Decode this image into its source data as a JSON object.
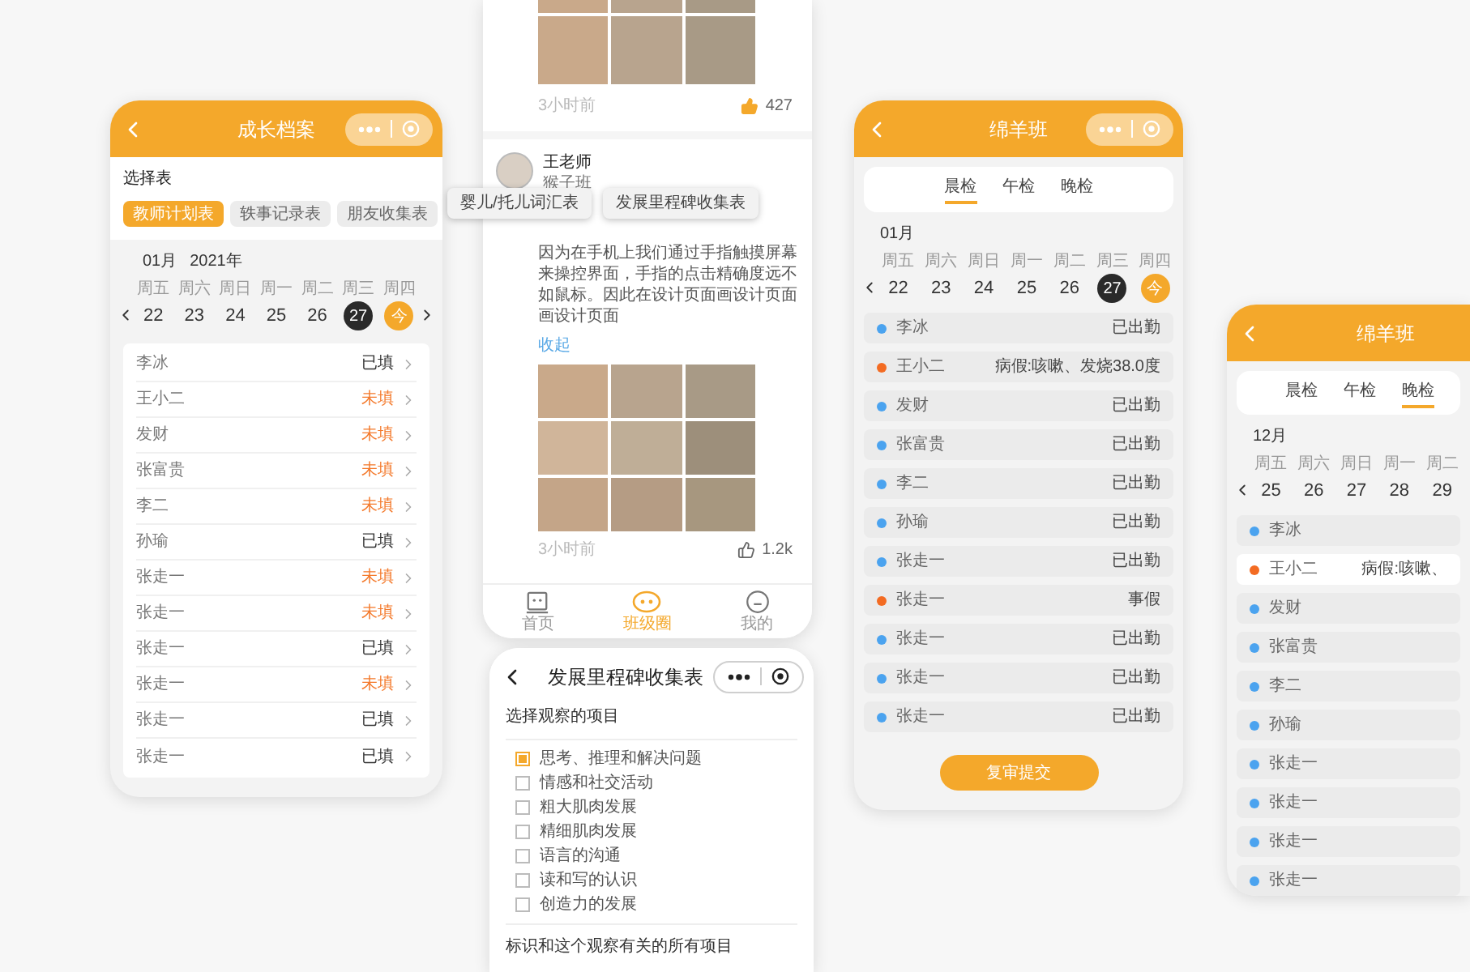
{
  "growth_screen": {
    "title": "成长档案",
    "section_label": "选择表",
    "chips": [
      {
        "label": "教师计划表",
        "selected": true
      },
      {
        "label": "轶事记录表",
        "selected": false
      },
      {
        "label": "朋友收集表",
        "selected": false
      }
    ],
    "month": "01月",
    "year": "2021年",
    "next_arrow": true,
    "days": [
      {
        "weekday": "周五",
        "date": "22",
        "kind": "normal"
      },
      {
        "weekday": "周六",
        "date": "23",
        "kind": "normal"
      },
      {
        "weekday": "周日",
        "date": "24",
        "kind": "normal"
      },
      {
        "weekday": "周一",
        "date": "25",
        "kind": "normal"
      },
      {
        "weekday": "周二",
        "date": "26",
        "kind": "normal"
      },
      {
        "weekday": "周三",
        "date": "27",
        "kind": "selected"
      },
      {
        "weekday": "周四",
        "date": "今",
        "kind": "today"
      }
    ],
    "students": [
      {
        "name": "李冰",
        "status": "已填",
        "filled": true
      },
      {
        "name": "王小二",
        "status": "未填",
        "filled": false
      },
      {
        "name": "发财",
        "status": "未填",
        "filled": false
      },
      {
        "name": "张富贵",
        "status": "未填",
        "filled": false
      },
      {
        "name": "李二",
        "status": "未填",
        "filled": false
      },
      {
        "name": "孙瑜",
        "status": "已填",
        "filled": true
      },
      {
        "name": "张走一",
        "status": "未填",
        "filled": false
      },
      {
        "name": "张走一",
        "status": "未填",
        "filled": false
      },
      {
        "name": "张走一",
        "status": "已填",
        "filled": true
      },
      {
        "name": "张走一",
        "status": "未填",
        "filled": false
      },
      {
        "name": "张走一",
        "status": "已填",
        "filled": true
      },
      {
        "name": "张走一",
        "status": "已填",
        "filled": true
      }
    ]
  },
  "floating_chips": [
    "婴儿/托儿词汇表",
    "发展里程碑收集表"
  ],
  "feed_screen": {
    "previous_post": {
      "time": "3小时前",
      "likes": "427",
      "liked": true
    },
    "post": {
      "author": "王老师",
      "class_name": "猴子班",
      "text": "因为在手机上我们通过手指触摸屏幕来操控界面，手指的点击精确度远不如鼠标。因此在设计页面画设计页面画设计页面",
      "collapse_link": "收起",
      "time": "3小时前",
      "likes": "1.2k",
      "liked": false
    },
    "nav": [
      {
        "label": "首页",
        "kind": "home",
        "selected": false
      },
      {
        "label": "班级圈",
        "kind": "circle",
        "selected": true
      },
      {
        "label": "我的",
        "kind": "profile",
        "selected": false
      }
    ]
  },
  "checklist_screen": {
    "title": "发展里程碑收集表",
    "section_label": "选择观察的项目",
    "items": [
      {
        "label": "思考、推理和解决问题",
        "checked": true
      },
      {
        "label": "情感和社交活动",
        "checked": false
      },
      {
        "label": "粗大肌肉发展",
        "checked": false
      },
      {
        "label": "精细肌肉发展",
        "checked": false
      },
      {
        "label": "语言的沟通",
        "checked": false
      },
      {
        "label": "读和写的认识",
        "checked": false
      },
      {
        "label": "创造力的发展",
        "checked": false
      }
    ],
    "second_section_label": "标识和这个观察有关的所有项目"
  },
  "attendance_screen": {
    "title": "绵羊班",
    "tabs": [
      {
        "label": "晨检",
        "selected": true
      },
      {
        "label": "午检",
        "selected": false
      },
      {
        "label": "晚检",
        "selected": false
      }
    ],
    "month": "01月",
    "next_arrow": false,
    "days": [
      {
        "weekday": "周五",
        "date": "22",
        "kind": "normal"
      },
      {
        "weekday": "周六",
        "date": "23",
        "kind": "normal"
      },
      {
        "weekday": "周日",
        "date": "24",
        "kind": "normal"
      },
      {
        "weekday": "周一",
        "date": "25",
        "kind": "normal"
      },
      {
        "weekday": "周二",
        "date": "26",
        "kind": "normal"
      },
      {
        "weekday": "周三",
        "date": "27",
        "kind": "selected"
      },
      {
        "weekday": "周四",
        "date": "今",
        "kind": "today"
      }
    ],
    "students": [
      {
        "name": "李冰",
        "status": "已出勤",
        "color": "#4ba3ef"
      },
      {
        "name": "王小二",
        "status": "病假:咳嗽、发烧38.0度",
        "color": "#f36b22"
      },
      {
        "name": "发财",
        "status": "已出勤",
        "color": "#4ba3ef"
      },
      {
        "name": "张富贵",
        "status": "已出勤",
        "color": "#4ba3ef"
      },
      {
        "name": "李二",
        "status": "已出勤",
        "color": "#4ba3ef"
      },
      {
        "name": "孙瑜",
        "status": "已出勤",
        "color": "#4ba3ef"
      },
      {
        "name": "张走一",
        "status": "已出勤",
        "color": "#4ba3ef"
      },
      {
        "name": "张走一",
        "status": "事假",
        "color": "#f36b22"
      },
      {
        "name": "张走一",
        "status": "已出勤",
        "color": "#4ba3ef"
      },
      {
        "name": "张走一",
        "status": "已出勤",
        "color": "#4ba3ef"
      },
      {
        "name": "张走一",
        "status": "已出勤",
        "color": "#4ba3ef"
      }
    ],
    "submit_button": "复审提交"
  },
  "evening_screen": {
    "title": "绵羊班",
    "tabs": [
      {
        "label": "晨检",
        "selected": false
      },
      {
        "label": "午检",
        "selected": false
      },
      {
        "label": "晚检",
        "selected": true
      }
    ],
    "month": "12月",
    "next_arrow": false,
    "days": [
      {
        "weekday": "周五",
        "date": "25",
        "kind": "normal"
      },
      {
        "weekday": "周六",
        "date": "26",
        "kind": "normal"
      },
      {
        "weekday": "周日",
        "date": "27",
        "kind": "normal"
      },
      {
        "weekday": "周一",
        "date": "28",
        "kind": "normal"
      },
      {
        "weekday": "周二",
        "date": "29",
        "kind": "normal"
      }
    ],
    "students": [
      {
        "name": "李冰",
        "color": "#4ba3ef",
        "highlighted": false
      },
      {
        "name": "王小二",
        "status": "病假:咳嗽、",
        "color": "#f36b22",
        "highlighted": true
      },
      {
        "name": "发财",
        "color": "#4ba3ef",
        "highlighted": false
      },
      {
        "name": "张富贵",
        "color": "#4ba3ef",
        "highlighted": false
      },
      {
        "name": "李二",
        "color": "#4ba3ef",
        "highlighted": false
      },
      {
        "name": "孙瑜",
        "color": "#4ba3ef",
        "highlighted": false
      },
      {
        "name": "张走一",
        "color": "#4ba3ef",
        "highlighted": false
      },
      {
        "name": "张走一",
        "color": "#4ba3ef",
        "highlighted": false
      },
      {
        "name": "张走一",
        "color": "#4ba3ef",
        "highlighted": false
      },
      {
        "name": "张走一",
        "color": "#4ba3ef",
        "highlighted": false
      }
    ]
  }
}
